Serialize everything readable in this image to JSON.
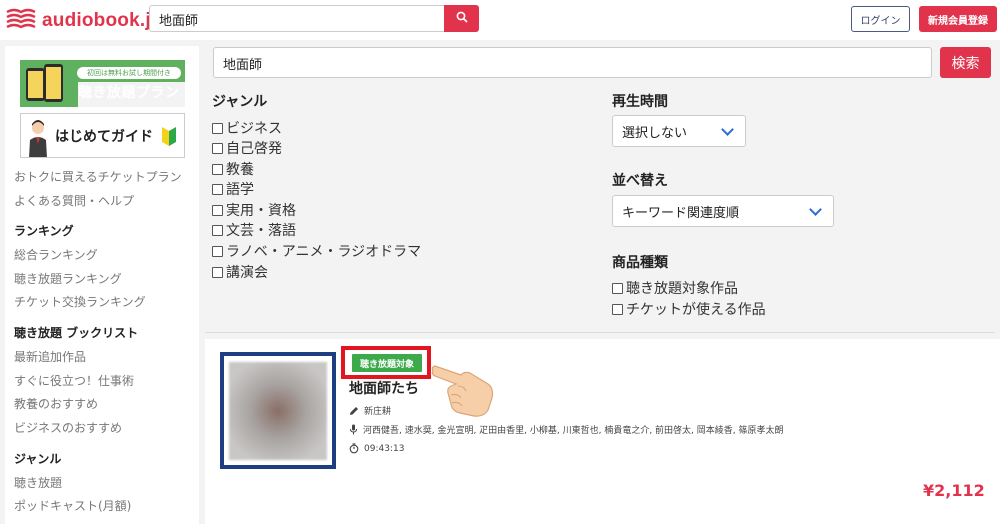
{
  "header": {
    "logo_text": "audiobook.jp",
    "search_value": "地面師",
    "login_label": "ログイン",
    "signup_label": "新規会員登録",
    "brand_color": "#e2334d"
  },
  "sidebar": {
    "banner_plan": {
      "tag": "初回は無料お試し期間付き",
      "title": "聴き放題プラン"
    },
    "banner_guide": {
      "title": "はじめてガイド"
    },
    "links_top": [
      "おトクに買えるチケットプラン",
      "よくある質問・ヘルプ"
    ],
    "ranking": {
      "heading": "ランキング",
      "items": [
        "総合ランキング",
        "聴き放題ランキング",
        "チケット交換ランキング"
      ]
    },
    "booklist": {
      "heading": "聴き放題 ブックリスト",
      "items": [
        "最新追加作品",
        "すぐに役立つ！仕事術",
        "教養のおすすめ",
        "ビジネスのおすすめ"
      ]
    },
    "genre": {
      "heading": "ジャンル",
      "items": [
        "聴き放題",
        "ポッドキャスト(月額)"
      ]
    }
  },
  "search": {
    "value": "地面師",
    "button_label": "検索"
  },
  "filters": {
    "genre_heading": "ジャンル",
    "genres": [
      "ビジネス",
      "自己啓発",
      "教養",
      "語学",
      "実用・資格",
      "文芸・落語",
      "ラノベ・アニメ・ラジオドラマ",
      "講演会"
    ],
    "duration_heading": "再生時間",
    "duration_value": "選択しない",
    "sort_heading": "並べ替え",
    "sort_value": "キーワード関連度順",
    "type_heading": "商品種類",
    "types": [
      "聴き放題対象作品",
      "チケットが使える作品"
    ]
  },
  "result": {
    "badge": "聴き放題対象",
    "title": "地面師たち",
    "author": "新庄耕",
    "narrators": "河西健吾, 速水奨, 金光宣明, 疋田由香里, 小柳基, 川東哲也, 楠貴竜之介, 前田啓太, 岡本綾香, 篠原孝太朗",
    "duration": "09:43:13",
    "price": "¥2,112"
  }
}
